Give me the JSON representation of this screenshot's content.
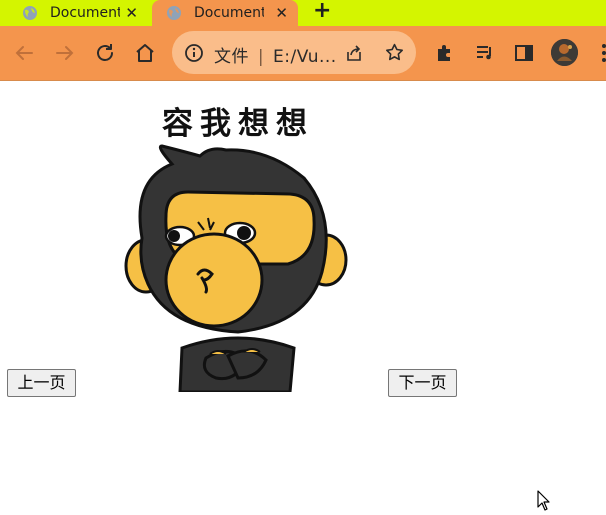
{
  "browser": {
    "tabs": [
      {
        "title": "Document",
        "active": false,
        "close": "✕"
      },
      {
        "title": "Document",
        "active": true,
        "close": "✕"
      }
    ],
    "new_tab": "+",
    "omnibox": {
      "scheme_label": "文件",
      "url": "E:/Vu..."
    },
    "colors": {
      "tab_strip": "#d4f500",
      "toolbar": "#f4954d",
      "omnibox": "#fabd8a"
    }
  },
  "page": {
    "meme_caption": "容我想想",
    "prev_button": "上一页",
    "next_button": "下一页"
  }
}
